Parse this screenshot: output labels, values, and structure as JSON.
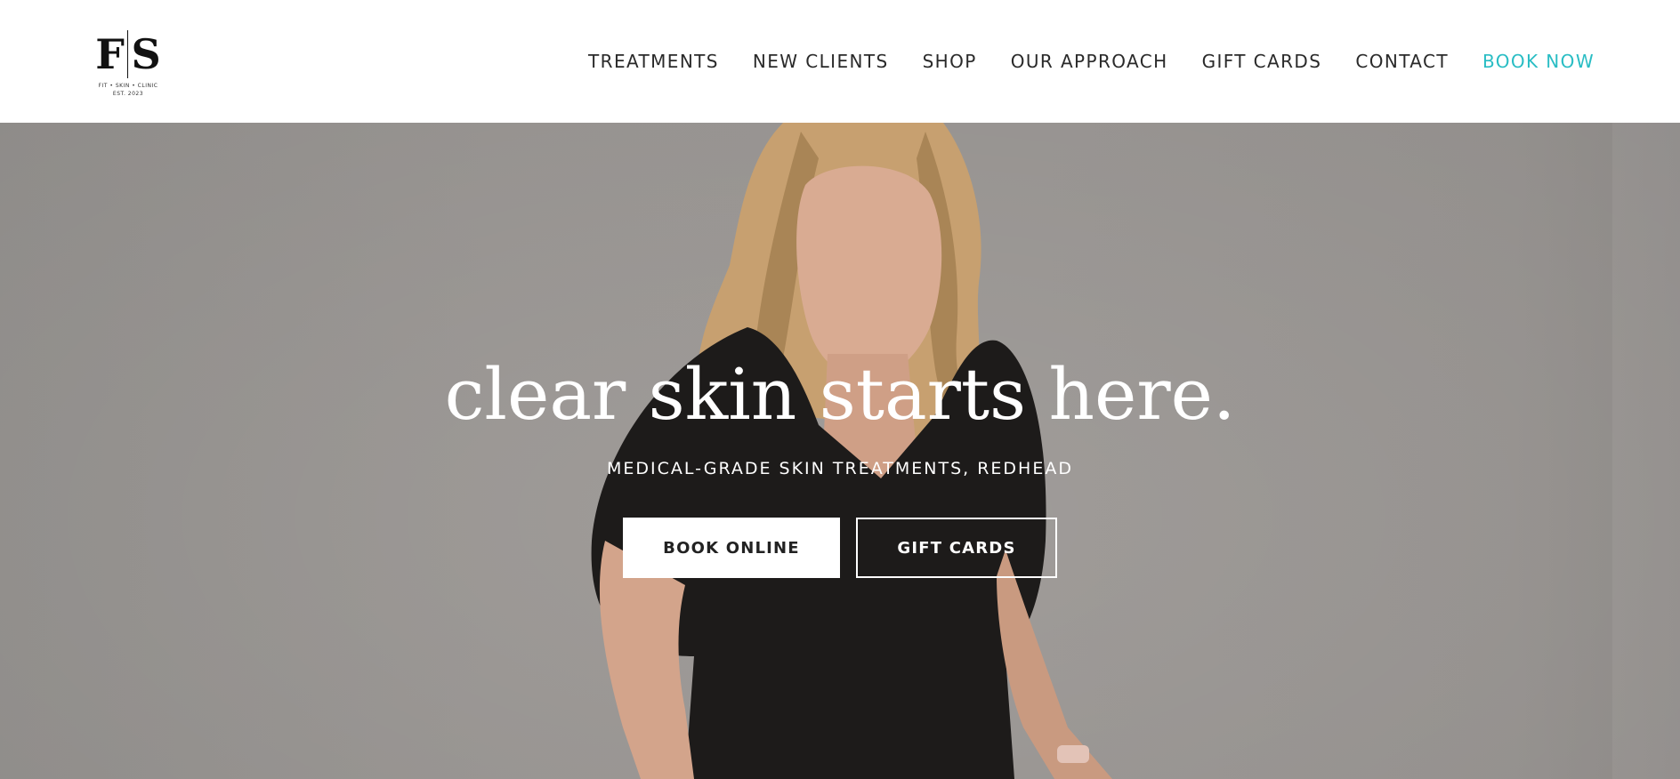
{
  "brand": {
    "letters": [
      "F",
      "S"
    ],
    "tagline": "FIT • SKIN • CLINIC",
    "established": "EST. 2023"
  },
  "nav": {
    "items": [
      {
        "label": "TREATMENTS"
      },
      {
        "label": "NEW CLIENTS"
      },
      {
        "label": "SHOP"
      },
      {
        "label": "OUR APPROACH"
      },
      {
        "label": "GIFT CARDS"
      },
      {
        "label": "CONTACT"
      },
      {
        "label": "BOOK NOW"
      }
    ]
  },
  "hero": {
    "title": "clear skin starts here.",
    "subtitle": "MEDICAL-GRADE SKIN TREATMENTS, REDHEAD",
    "buttons": {
      "primary": "BOOK ONLINE",
      "secondary": "GIFT CARDS"
    }
  },
  "colors": {
    "accent": "#29bdc4",
    "header_bg": "#ffffff",
    "hero_bg": "#a8a4a1",
    "nav_text": "#2a2a2a"
  }
}
